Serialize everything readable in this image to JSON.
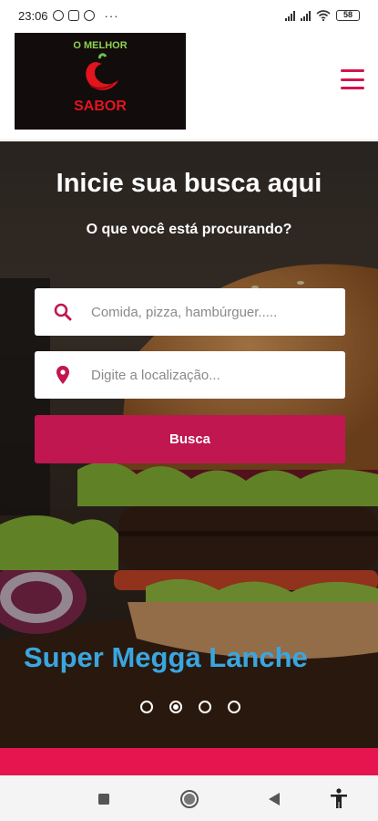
{
  "status_bar": {
    "time": "23:06",
    "more": "···",
    "battery": "58"
  },
  "header": {
    "logo": {
      "top_text": "O MELHOR",
      "bottom_text": "SABOR"
    },
    "menu_icon": "hamburger-menu-icon",
    "colors": {
      "accent": "#d4144b"
    }
  },
  "hero": {
    "title": "Inicie sua busca aqui",
    "subtitle": "O que você está procurando?",
    "search": {
      "placeholder": "Comida, pizza, hambúrguer.....",
      "value": "",
      "icon": "search-icon"
    },
    "location": {
      "placeholder": "Digite a localização...",
      "value": "",
      "icon": "map-pin-icon"
    },
    "button_label": "Busca",
    "slide_caption": "Super Megga Lanche",
    "carousel": {
      "count": 4,
      "active_index": 1
    },
    "colors": {
      "button": "#c01750",
      "caption": "#3aa6e0"
    }
  },
  "nav_bar": {
    "icons": [
      "square-recents-icon",
      "circle-home-icon",
      "triangle-back-icon",
      "accessibility-icon"
    ]
  }
}
